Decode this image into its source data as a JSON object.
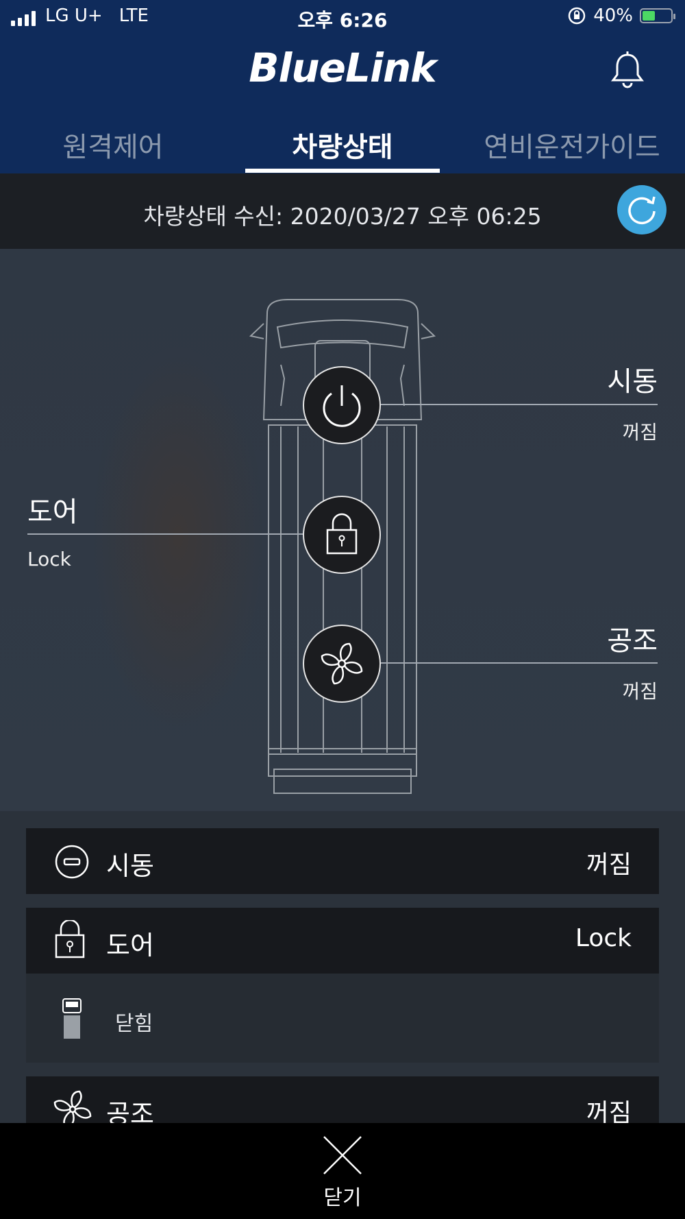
{
  "status_bar": {
    "carrier": "LG U+",
    "network": "LTE",
    "time": "오후 6:26",
    "battery": "40%",
    "battery_level": 0.4,
    "battery_color": "#4cd964"
  },
  "header": {
    "logo": "BlueLink",
    "notification_icon": "bell-icon"
  },
  "tabs": [
    {
      "label": "원격제어",
      "active": false
    },
    {
      "label": "차량상태",
      "active": true
    },
    {
      "label": "연비운전가이드",
      "active": false
    }
  ],
  "receive": {
    "text": "차량상태 수신: 2020/03/27 오후 06:25",
    "refresh_icon": "refresh-icon",
    "accent": "#3ea6dd"
  },
  "hero": {
    "engine": {
      "label": "시동",
      "value": "꺼짐",
      "icon": "power-icon"
    },
    "door": {
      "label": "도어",
      "value": "Lock",
      "icon": "lock-icon"
    },
    "climate": {
      "label": "공조",
      "value": "꺼짐",
      "icon": "fan-icon"
    }
  },
  "list": {
    "engine": {
      "label": "시동",
      "value": "꺼짐",
      "icon": "engine-off-icon"
    },
    "door": {
      "label": "도어",
      "value": "Lock",
      "icon": "lock-icon",
      "detail": {
        "label": "닫힘",
        "icon": "car-door-closed-icon"
      }
    },
    "climate": {
      "label": "공조",
      "value": "꺼짐",
      "icon": "fan-icon"
    }
  },
  "close": {
    "label": "닫기",
    "icon": "close-icon"
  }
}
